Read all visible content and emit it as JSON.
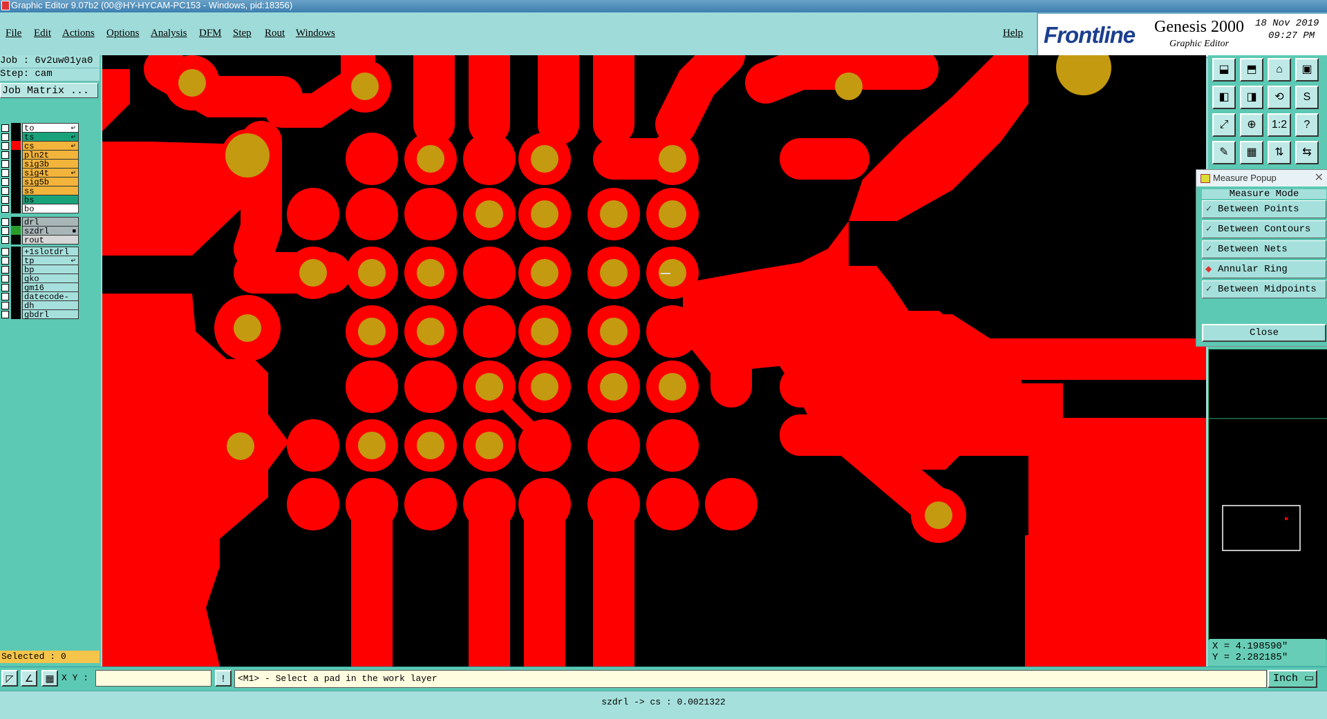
{
  "window": {
    "title": "Graphic Editor 9.07b2 (00@HY-HYCAM-PC153 - Windows, pid:18356)"
  },
  "menu": {
    "items": [
      "File",
      "Edit",
      "Actions",
      "Options",
      "Analysis",
      "DFM",
      "Step",
      "Rout",
      "Windows"
    ],
    "help": "Help"
  },
  "brand": {
    "logo": "Frontline",
    "product": "Genesis 2000",
    "subtitle": "Graphic Editor",
    "date": "18 Nov 2019",
    "time": "09:27 PM"
  },
  "job": {
    "job_label": "Job : 6v2uw01ya0",
    "step_label": "Step: cam",
    "matrix_button": "Job Matrix ..."
  },
  "layers": [
    {
      "name": "to",
      "color": "#ffffff",
      "swatch": "#000000",
      "mark": "arrow"
    },
    {
      "name": "ts",
      "color": "#1aa37a",
      "swatch": "#000000",
      "mark": "arrow"
    },
    {
      "name": "cs",
      "color": "#f2b43b",
      "swatch": "#ff0000",
      "mark": "arrow"
    },
    {
      "name": "pln2t",
      "color": "#f2b43b",
      "swatch": "#000000",
      "mark": ""
    },
    {
      "name": "sig3b",
      "color": "#f2b43b",
      "swatch": "#000000",
      "mark": ""
    },
    {
      "name": "sig4t",
      "color": "#f2b43b",
      "swatch": "#000000",
      "mark": "arrow"
    },
    {
      "name": "sig5b",
      "color": "#f2b43b",
      "swatch": "#000000",
      "mark": ""
    },
    {
      "name": "ss",
      "color": "#f2b43b",
      "swatch": "#000000",
      "mark": ""
    },
    {
      "name": "bs",
      "color": "#1aa37a",
      "swatch": "#000000",
      "mark": ""
    },
    {
      "name": "bo",
      "color": "#ffffff",
      "swatch": "#000000",
      "mark": ""
    },
    {
      "name": "drl",
      "color": "#a8b6b8",
      "swatch": "#000000",
      "mark": ""
    },
    {
      "name": "szdrl",
      "color": "#a8b6b8",
      "swatch": "#2a9b2a",
      "mark": "square"
    },
    {
      "name": "rout",
      "color": "#d6d6d6",
      "swatch": "#000000",
      "mark": ""
    },
    {
      "name": "+1slotdrl",
      "color": "#a6e0dc",
      "swatch": "#000000",
      "mark": ""
    },
    {
      "name": "tp",
      "color": "#a6e0dc",
      "swatch": "#000000",
      "mark": "arrow"
    },
    {
      "name": "bp",
      "color": "#a6e0dc",
      "swatch": "#000000",
      "mark": ""
    },
    {
      "name": "gko",
      "color": "#a6e0dc",
      "swatch": "#000000",
      "mark": ""
    },
    {
      "name": "gm16",
      "color": "#a6e0dc",
      "swatch": "#000000",
      "mark": ""
    },
    {
      "name": "datecode-to",
      "color": "#a6e0dc",
      "swatch": "#000000",
      "mark": ""
    },
    {
      "name": "dh",
      "color": "#a6e0dc",
      "swatch": "#000000",
      "mark": ""
    },
    {
      "name": "gbdrl",
      "color": "#a6e0dc",
      "swatch": "#000000",
      "mark": ""
    }
  ],
  "selected": "Selected : 0",
  "toolbar_icons": [
    "zoom-home-icon",
    "zoom-in-icon",
    "home-icon",
    "window-icon",
    "pan-left-icon",
    "pan-right-icon",
    "redraw-icon",
    "snap-icon",
    "fit-icon",
    "zoom-extents-icon",
    "scale-1-2-icon",
    "help-icon",
    "measure-icon",
    "grid-icon",
    "layers-icon",
    "layers-icon-2"
  ],
  "toolbar_glyphs": [
    "⬓",
    "⬒",
    "⌂",
    "▣",
    "◧",
    "◨",
    "⟲",
    "S",
    "⤢",
    "⊕",
    "1:2",
    "?",
    "✎",
    "▦",
    "⇅",
    "⇆"
  ],
  "measure_popup": {
    "title": "Measure Popup",
    "mode_label": "Measure Mode",
    "options": [
      {
        "label": "Between Points",
        "checked": false
      },
      {
        "label": "Between Contours",
        "checked": false
      },
      {
        "label": "Between Nets",
        "checked": false
      },
      {
        "label": "Annular Ring",
        "checked": true
      },
      {
        "label": "Between Midpoints",
        "checked": false
      }
    ],
    "close_label": "Close"
  },
  "coords": {
    "x": "X = 4.198590\"",
    "y": "Y = 2.282185\""
  },
  "bottom": {
    "xy_label": "X Y :",
    "xy_value": "",
    "prompt": "<M1> - Select a pad in the work layer",
    "unit": "Inch ▭"
  },
  "status": "szdrl -> cs : 0.0021322",
  "colors": {
    "copper": "#ff0000",
    "drill": "#c49a10",
    "background": "#000000"
  }
}
